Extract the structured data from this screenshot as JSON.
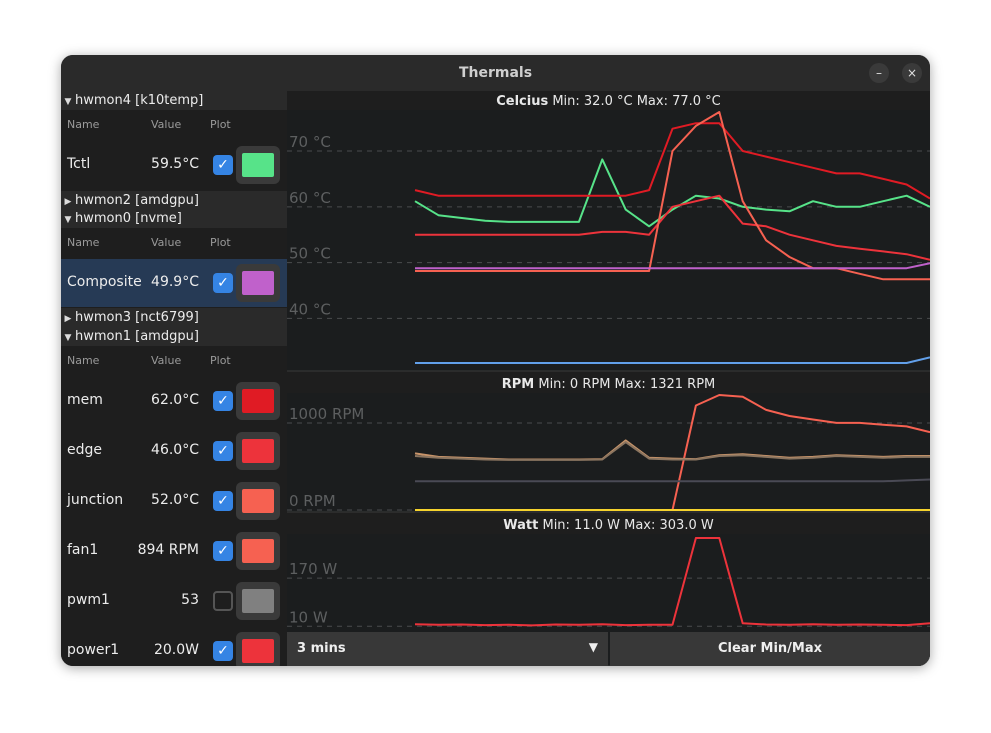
{
  "window": {
    "title": "Thermals",
    "minimize_glyph": "–",
    "close_glyph": "×"
  },
  "column_headers": {
    "name": "Name",
    "value": "Value",
    "plot": "Plot"
  },
  "groups": [
    {
      "label": "hwmon4 [k10temp]",
      "expanded": true
    },
    {
      "label": "hwmon2 [amdgpu]",
      "expanded": false
    },
    {
      "label": "hwmon0 [nvme]",
      "expanded": true
    },
    {
      "label": "hwmon3 [nct6799]",
      "expanded": false
    },
    {
      "label": "hwmon1 [amdgpu]",
      "expanded": true
    }
  ],
  "sensors": [
    {
      "name": "Tctl",
      "value": "59.5°C",
      "plot": true,
      "color": "#57e389",
      "selected": false
    },
    {
      "name": "Composite",
      "value": "49.9°C",
      "plot": true,
      "color": "#c061cb",
      "selected": true
    },
    {
      "name": "mem",
      "value": "62.0°C",
      "plot": true,
      "color": "#e01b24",
      "selected": false
    },
    {
      "name": "edge",
      "value": "46.0°C",
      "plot": true,
      "color": "#ed333b",
      "selected": false
    },
    {
      "name": "junction",
      "value": "52.0°C",
      "plot": true,
      "color": "#f66151",
      "selected": false
    },
    {
      "name": "fan1",
      "value": "894 RPM",
      "plot": true,
      "color": "#f66151",
      "selected": false
    },
    {
      "name": "pwm1",
      "value": "53",
      "plot": false,
      "color": "#808080",
      "selected": false
    },
    {
      "name": "power1",
      "value": "20.0W",
      "plot": true,
      "color": "#ed333b",
      "selected": false
    }
  ],
  "check_glyph": "✓",
  "bottom": {
    "range_label": "3 mins",
    "dropdown_glyph": "▼",
    "clear_label": "Clear Min/Max"
  },
  "chart_data": [
    {
      "type": "line",
      "title": "Celcius",
      "summary": "Min: 32.0 °C Max: 77.0 °C",
      "ylim": [
        32,
        77
      ],
      "yticks": [
        70,
        60,
        50,
        40
      ],
      "ytick_labels": [
        "70 °C",
        "60 °C",
        "50 °C",
        "40 °C"
      ],
      "x": [
        0,
        1,
        2,
        3,
        4,
        5,
        6,
        7,
        8,
        9,
        10,
        11,
        12,
        13,
        14,
        15,
        16,
        17,
        18,
        19,
        20,
        21,
        22
      ],
      "series": [
        {
          "color": "#57e389",
          "values": [
            61,
            58.5,
            58,
            57.5,
            57.3,
            57.3,
            57.3,
            57.3,
            68.5,
            59.5,
            56.5,
            59.5,
            62,
            61.5,
            60,
            59.5,
            59.2,
            61,
            60,
            60,
            61,
            62,
            60
          ]
        },
        {
          "color": "#e01b24",
          "values": [
            63,
            62,
            62,
            62,
            62,
            62,
            62,
            62,
            62,
            62,
            63,
            74,
            75,
            75,
            70,
            69,
            68,
            67,
            66,
            66,
            65,
            64,
            61.5
          ]
        },
        {
          "color": "#ed333b",
          "values": [
            55,
            55,
            55,
            55,
            55,
            55,
            55,
            55,
            55.5,
            55.5,
            55,
            60,
            61,
            62,
            57,
            56.5,
            55,
            54,
            53,
            52.5,
            52,
            51.5,
            50.5
          ]
        },
        {
          "color": "#f66151",
          "values": [
            48.5,
            48.5,
            48.5,
            48.5,
            48.5,
            48.5,
            48.5,
            48.5,
            48.5,
            48.5,
            48.5,
            70,
            74.5,
            77,
            61,
            54,
            51,
            49,
            49,
            48,
            47,
            47,
            47
          ]
        },
        {
          "color": "#c061cb",
          "values": [
            49,
            49,
            49,
            49,
            49,
            49,
            49,
            49,
            49,
            49,
            49,
            49,
            49,
            49,
            49,
            49,
            49,
            49,
            49,
            49,
            49,
            49,
            49.9
          ]
        },
        {
          "color": "#62a0ea",
          "values": [
            32,
            32,
            32,
            32,
            32,
            32,
            32,
            32,
            32,
            32,
            32,
            32,
            32,
            32,
            32,
            32,
            32,
            32,
            32,
            32,
            32,
            32,
            33
          ]
        }
      ]
    },
    {
      "type": "line",
      "title": "RPM",
      "summary": "Min: 0 RPM Max: 1321 RPM",
      "ylim": [
        0,
        1321
      ],
      "yticks": [
        1000,
        0
      ],
      "ytick_labels": [
        "1000 RPM",
        "0 RPM"
      ],
      "x": [
        0,
        1,
        2,
        3,
        4,
        5,
        6,
        7,
        8,
        9,
        10,
        11,
        12,
        13,
        14,
        15,
        16,
        17,
        18,
        19,
        20,
        21,
        22
      ],
      "series": [
        {
          "color": "#f66151",
          "values": [
            0,
            0,
            0,
            0,
            0,
            0,
            0,
            0,
            0,
            0,
            0,
            0,
            1200,
            1321,
            1300,
            1150,
            1080,
            1040,
            1000,
            1000,
            980,
            960,
            894
          ]
        },
        {
          "color": "#c8946a",
          "values": [
            650,
            610,
            600,
            590,
            580,
            580,
            580,
            580,
            585,
            800,
            600,
            590,
            585,
            630,
            640,
            620,
            600,
            610,
            630,
            620,
            610,
            620,
            620
          ]
        },
        {
          "color": "#8b7560",
          "values": [
            620,
            600,
            590,
            580,
            575,
            575,
            575,
            575,
            580,
            780,
            590,
            580,
            580,
            620,
            630,
            610,
            590,
            600,
            620,
            610,
            600,
            610,
            610
          ]
        },
        {
          "color": "#4a4a55",
          "values": [
            330,
            330,
            330,
            330,
            330,
            330,
            330,
            330,
            330,
            330,
            330,
            330,
            330,
            330,
            330,
            330,
            330,
            330,
            330,
            330,
            330,
            340,
            350
          ]
        },
        {
          "color": "#f6d32d",
          "values": [
            0,
            0,
            0,
            0,
            0,
            0,
            0,
            0,
            0,
            0,
            0,
            0,
            0,
            0,
            0,
            0,
            0,
            0,
            0,
            0,
            0,
            0,
            0
          ]
        }
      ]
    },
    {
      "type": "line",
      "title": "Watt",
      "summary": "Min: 11.0 W Max: 303.0 W",
      "ylim": [
        11,
        303
      ],
      "yticks": [
        170,
        10
      ],
      "ytick_labels": [
        "170 W",
        "10 W"
      ],
      "x": [
        0,
        1,
        2,
        3,
        4,
        5,
        6,
        7,
        8,
        9,
        10,
        11,
        12,
        13,
        14,
        15,
        16,
        17,
        18,
        19,
        20,
        21,
        22
      ],
      "series": [
        {
          "color": "#ed333b",
          "values": [
            17,
            15,
            16,
            14,
            15,
            13,
            16,
            15,
            17,
            14,
            15,
            15,
            303,
            303,
            20,
            16,
            15,
            17,
            15,
            16,
            15,
            14,
            20
          ]
        }
      ]
    }
  ]
}
